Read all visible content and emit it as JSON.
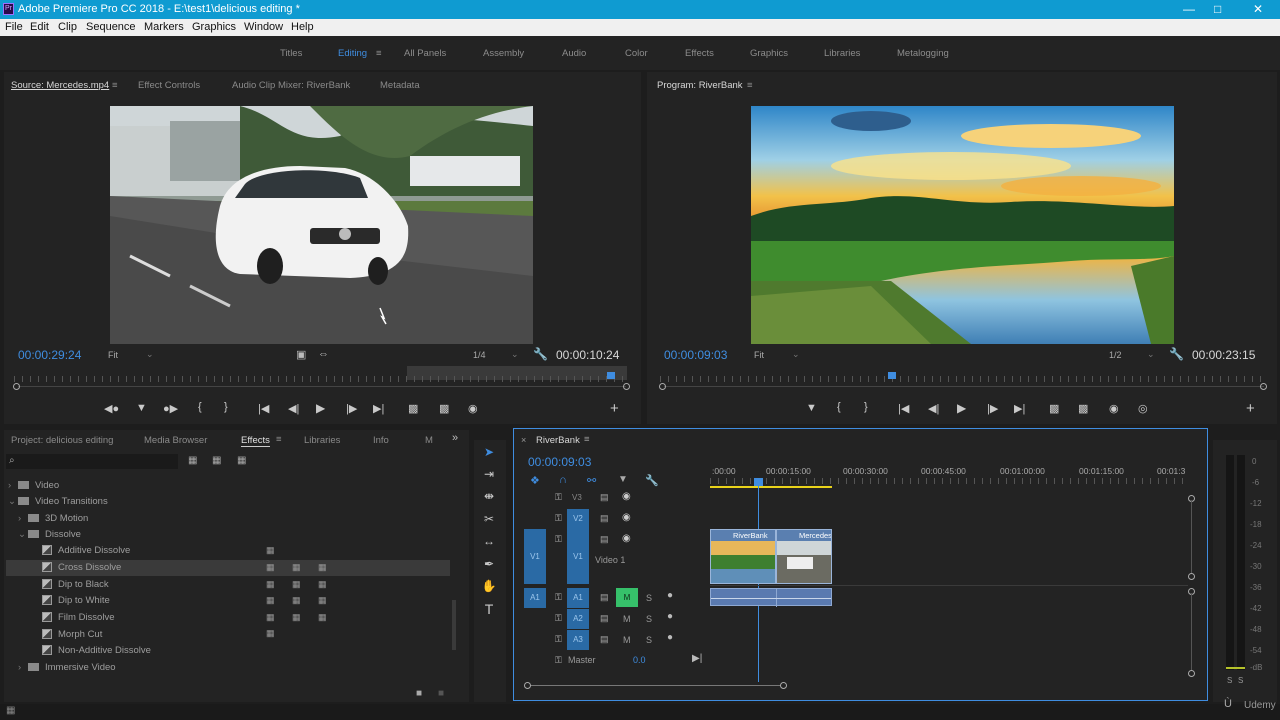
{
  "app": {
    "title": "Adobe Premiere Pro CC 2018 - E:\\test1\\delicious editing *",
    "logo": "Pr"
  },
  "menu": [
    "File",
    "Edit",
    "Clip",
    "Sequence",
    "Markers",
    "Graphics",
    "Window",
    "Help"
  ],
  "workspaces": [
    "Titles",
    "Editing",
    "All Panels",
    "Assembly",
    "Audio",
    "Color",
    "Effects",
    "Graphics",
    "Libraries",
    "Metalogging"
  ],
  "source_panel": {
    "tabs": [
      "Source: Mercedes.mp4",
      "Effect Controls",
      "Audio Clip Mixer: RiverBank",
      "Metadata"
    ],
    "timecode": "00:00:29:24",
    "fit": "Fit",
    "resolution": "1/4",
    "duration": "00:00:10:24"
  },
  "program_panel": {
    "tab": "Program: RiverBank",
    "timecode": "00:00:09:03",
    "fit": "Fit",
    "resolution": "1/2",
    "duration": "00:00:23:15"
  },
  "project_panel": {
    "tabs": [
      "Project: delicious editing",
      "Media Browser",
      "Effects",
      "Libraries",
      "Info",
      "M"
    ],
    "tree": [
      {
        "label": "Video",
        "type": "folder",
        "depth": 0,
        "expanded": false
      },
      {
        "label": "Video Transitions",
        "type": "folder",
        "depth": 0,
        "expanded": true
      },
      {
        "label": "3D Motion",
        "type": "folder",
        "depth": 1,
        "expanded": false
      },
      {
        "label": "Dissolve",
        "type": "folder",
        "depth": 1,
        "expanded": true
      },
      {
        "label": "Additive Dissolve",
        "type": "item",
        "depth": 2
      },
      {
        "label": "Cross Dissolve",
        "type": "item",
        "depth": 2,
        "selected": true
      },
      {
        "label": "Dip to Black",
        "type": "item",
        "depth": 2
      },
      {
        "label": "Dip to White",
        "type": "item",
        "depth": 2
      },
      {
        "label": "Film Dissolve",
        "type": "item",
        "depth": 2
      },
      {
        "label": "Morph Cut",
        "type": "item",
        "depth": 2
      },
      {
        "label": "Non-Additive Dissolve",
        "type": "item",
        "depth": 2
      },
      {
        "label": "Immersive Video",
        "type": "folder",
        "depth": 1,
        "expanded": false
      }
    ]
  },
  "timeline": {
    "sequence": "RiverBank",
    "timecode": "00:00:09:03",
    "ruler": [
      ":00:00",
      "00:00:15:00",
      "00:00:30:00",
      "00:00:45:00",
      "00:01:00:00",
      "00:01:15:00",
      "00:01:3"
    ],
    "tracks": {
      "video": [
        "V3",
        "V2",
        "V1"
      ],
      "audio": [
        "A1",
        "A2",
        "A3"
      ],
      "video_label": "Video 1",
      "master": "Master",
      "master_value": "0.0"
    },
    "clips": [
      "RiverBank",
      "Mercedes"
    ],
    "mute": "M",
    "solo": "S"
  },
  "audio_meter": {
    "scale": [
      "0",
      "-6",
      "-12",
      "-18",
      "-24",
      "-30",
      "-36",
      "-42",
      "-48",
      "-54",
      "-dB"
    ],
    "solo": [
      "S",
      "S"
    ]
  },
  "watermark": "Udemy"
}
